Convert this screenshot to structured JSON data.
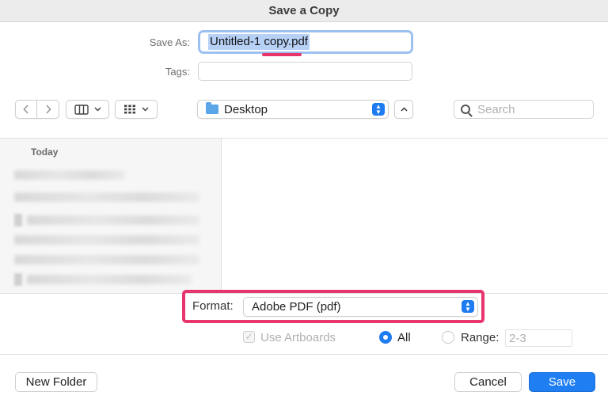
{
  "window": {
    "title": "Save a Copy"
  },
  "form": {
    "save_as_label": "Save As:",
    "save_as_value": "Untitled-1 copy.pdf",
    "tags_label": "Tags:",
    "tags_value": ""
  },
  "toolbar": {
    "back_icon": "chevron-left",
    "forward_icon": "chevron-right",
    "columns_view_icon": "columns",
    "grid_view_icon": "grid",
    "location": "Desktop",
    "search_placeholder": "Search"
  },
  "sidebar": {
    "section_header": "Today"
  },
  "options": {
    "format_label": "Format:",
    "format_value": "Adobe PDF (pdf)",
    "use_artboards_label": "Use Artboards",
    "all_label": "All",
    "range_label": "Range:",
    "range_value": "2-3",
    "all_selected": true
  },
  "buttons": {
    "new_folder": "New Folder",
    "cancel": "Cancel",
    "save": "Save"
  },
  "colors": {
    "accent": "#1f7ef2",
    "highlight": "#e8356d",
    "selection": "#b7d1f6"
  }
}
